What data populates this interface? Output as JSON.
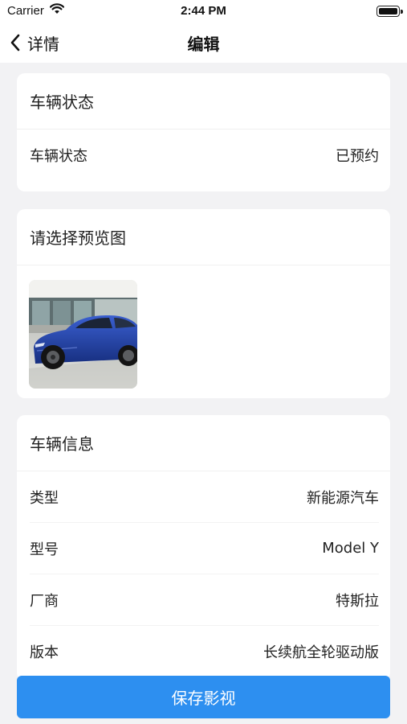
{
  "status_bar": {
    "carrier": "Carrier",
    "time": "2:44 PM"
  },
  "nav": {
    "back_label": "详情",
    "title": "编辑"
  },
  "status_card": {
    "header": "车辆状态",
    "row": {
      "label": "车辆状态",
      "value": "已预约"
    }
  },
  "preview_card": {
    "header": "请选择预览图"
  },
  "info_card": {
    "header": "车辆信息",
    "rows": [
      {
        "label": "类型",
        "value": "新能源汽车"
      },
      {
        "label": "型号",
        "value": "Model Y"
      },
      {
        "label": "厂商",
        "value": "特斯拉"
      },
      {
        "label": "版本",
        "value": "长续航全轮驱动版"
      }
    ]
  },
  "save_button": {
    "label": "保存影视"
  },
  "colors": {
    "accent": "#2d8ff0",
    "background": "#f2f2f4",
    "car_body": "#1e3f9e"
  }
}
